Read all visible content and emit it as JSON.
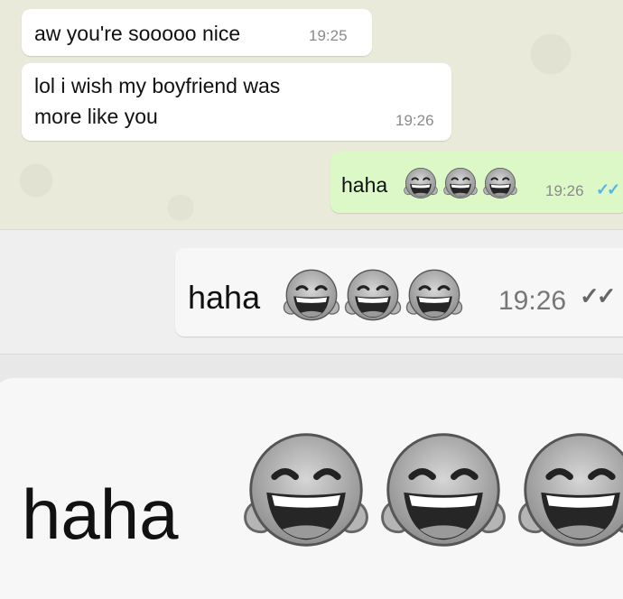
{
  "chat": {
    "messages": [
      {
        "text": "aw you're sooooo nice",
        "time": "19:25"
      },
      {
        "line1": "lol i wish my boyfriend was",
        "line2": "more like you",
        "time": "19:26"
      },
      {
        "text": "haha",
        "time": "19:26",
        "status": "read"
      }
    ]
  },
  "zoom1": {
    "text": "haha",
    "time": "19:26"
  },
  "zoom2": {
    "text": "haha"
  },
  "icons": {
    "emoji": "face-with-tears-of-joy-icon",
    "tick": "double-check-icon"
  },
  "colors": {
    "outgoing": "#dcf8c6",
    "incoming": "#ffffff",
    "read_tick": "#4fb6ec"
  }
}
